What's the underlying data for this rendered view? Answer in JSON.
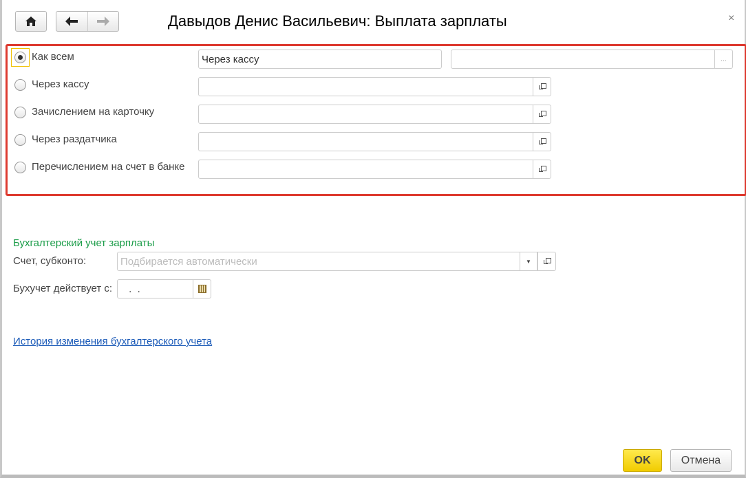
{
  "window": {
    "title": "Давыдов Денис Васильевич: Выплата зарплаты"
  },
  "nav": {
    "home": "home-icon",
    "back": "arrow-left-icon",
    "forward": "arrow-right-icon",
    "close": "×"
  },
  "payment": {
    "options": [
      {
        "label": "Как всем",
        "selected": true,
        "value": "Через кассу"
      },
      {
        "label": "Через кассу",
        "selected": false,
        "value": ""
      },
      {
        "label": "Зачислением на карточку",
        "selected": false,
        "value": ""
      },
      {
        "label": "Через раздатчика",
        "selected": false,
        "value": ""
      },
      {
        "label": "Перечислением на счет в банке",
        "selected": false,
        "value": ""
      }
    ],
    "extra_value": "",
    "ellipsis": "..."
  },
  "accounting": {
    "section_title": "Бухгалтерский учет зарплаты",
    "account_label": "Счет, субконто:",
    "account_placeholder": "Подбирается автоматически",
    "date_label": "Бухучет действует с:",
    "date_value": " .  .",
    "history_link": "История изменения бухгалтерского учета"
  },
  "footer": {
    "ok": "OK",
    "cancel": "Отмена"
  }
}
